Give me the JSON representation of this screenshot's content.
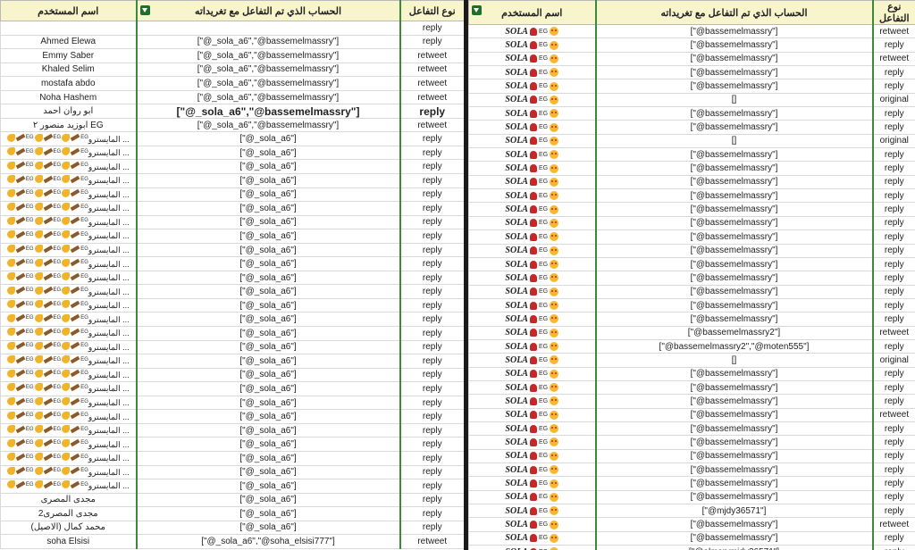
{
  "headers": {
    "interaction_type": "نوع التفاعل",
    "account": "الحساب الذي تم التفاعل مع تغريداته",
    "username": "اسم المستخدم"
  },
  "icons": {
    "filter": "filter-dropdown-icon"
  },
  "colors": {
    "header_bg": "#f8f5cc",
    "column_border": "#3b8a3b",
    "filter_button": "#1e6f2e",
    "divider": "#1a1a1a"
  },
  "left": {
    "rows": [
      {
        "u": "",
        "a": "",
        "t": "reply"
      },
      {
        "u": "Ahmed Elewa",
        "a": "[\"@_sola_a6\",\"@bassemelmassry\"]",
        "t": "reply"
      },
      {
        "u": "Emmy Saber",
        "a": "[\"@_sola_a6\",\"@bassemelmassry\"]",
        "t": "retweet"
      },
      {
        "u": "Khaled Selim",
        "a": "[\"@_sola_a6\",\"@bassemelmassry\"]",
        "t": "retweet"
      },
      {
        "u": "mostafa abdo",
        "a": "[\"@_sola_a6\",\"@bassemelmassry\"]",
        "t": "retweet"
      },
      {
        "u": "Noha Hashem",
        "a": "[\"@_sola_a6\",\"@bassemelmassry\"]",
        "t": "retweet"
      },
      {
        "u": "ابو روان احمد",
        "a": "[\"@_sola_a6\",\"@bassemelmassry\"]",
        "t": "reply",
        "bold": true
      },
      {
        "u": "ابوزيد منصور ٢ EG",
        "a": "[\"@_sola_a6\",\"@bassemelmassry\"]",
        "t": "retweet"
      },
      {
        "u": "المايسترو ...",
        "a": "[\"@_sola_a6\"]",
        "t": "reply",
        "deco": true
      },
      {
        "u": "المايسترو ...",
        "a": "[\"@_sola_a6\"]",
        "t": "reply",
        "deco": true
      },
      {
        "u": "المايسترو ...",
        "a": "[\"@_sola_a6\"]",
        "t": "reply",
        "deco": true
      },
      {
        "u": "المايسترو ...",
        "a": "[\"@_sola_a6\"]",
        "t": "reply",
        "deco": true
      },
      {
        "u": "المايسترو ...",
        "a": "[\"@_sola_a6\"]",
        "t": "reply",
        "deco": true
      },
      {
        "u": "المايسترو ...",
        "a": "[\"@_sola_a6\"]",
        "t": "reply",
        "deco": true
      },
      {
        "u": "المايسترو ...",
        "a": "[\"@_sola_a6\"]",
        "t": "reply",
        "deco": true
      },
      {
        "u": "المايسترو ...",
        "a": "[\"@_sola_a6\"]",
        "t": "reply",
        "deco": true
      },
      {
        "u": "المايسترو ...",
        "a": "[\"@_sola_a6\"]",
        "t": "reply",
        "deco": true
      },
      {
        "u": "المايسترو ...",
        "a": "[\"@_sola_a6\"]",
        "t": "reply",
        "deco": true
      },
      {
        "u": "المايسترو ...",
        "a": "[\"@_sola_a6\"]",
        "t": "reply",
        "deco": true
      },
      {
        "u": "المايسترو ...",
        "a": "[\"@_sola_a6\"]",
        "t": "reply",
        "deco": true
      },
      {
        "u": "المايسترو ...",
        "a": "[\"@_sola_a6\"]",
        "t": "reply",
        "deco": true
      },
      {
        "u": "المايسترو ...",
        "a": "[\"@_sola_a6\"]",
        "t": "reply",
        "deco": true
      },
      {
        "u": "المايسترو ...",
        "a": "[\"@_sola_a6\"]",
        "t": "reply",
        "deco": true
      },
      {
        "u": "المايسترو ...",
        "a": "[\"@_sola_a6\"]",
        "t": "reply",
        "deco": true
      },
      {
        "u": "المايسترو ...",
        "a": "[\"@_sola_a6\"]",
        "t": "reply",
        "deco": true
      },
      {
        "u": "المايسترو ...",
        "a": "[\"@_sola_a6\"]",
        "t": "reply",
        "deco": true
      },
      {
        "u": "المايسترو ...",
        "a": "[\"@_sola_a6\"]",
        "t": "reply",
        "deco": true
      },
      {
        "u": "المايسترو ...",
        "a": "[\"@_sola_a6\"]",
        "t": "reply",
        "deco": true
      },
      {
        "u": "المايسترو ...",
        "a": "[\"@_sola_a6\"]",
        "t": "reply",
        "deco": true
      },
      {
        "u": "المايسترو ...",
        "a": "[\"@_sola_a6\"]",
        "t": "reply",
        "deco": true
      },
      {
        "u": "المايسترو ...",
        "a": "[\"@_sola_a6\"]",
        "t": "reply",
        "deco": true
      },
      {
        "u": "المايسترو ...",
        "a": "[\"@_sola_a6\"]",
        "t": "reply",
        "deco": true
      },
      {
        "u": "المايسترو ...",
        "a": "[\"@_sola_a6\"]",
        "t": "reply",
        "deco": true
      },
      {
        "u": "المايسترو ...",
        "a": "[\"@_sola_a6\"]",
        "t": "reply",
        "deco": true
      },
      {
        "u": "مجدى المصرى",
        "a": "[\"@_sola_a6\"]",
        "t": "reply"
      },
      {
        "u": "مجدى المصرى2",
        "a": "[\"@_sola_a6\"]",
        "t": "reply"
      },
      {
        "u": "محمد كمال (الاصيل)",
        "a": "[\"@_sola_a6\"]",
        "t": "reply"
      },
      {
        "u": "soha Elsisi",
        "a": "[\"@_sola_a6\",\"@soha_elsisi777\"]",
        "t": "retweet"
      }
    ]
  },
  "right": {
    "user_label": "SOLA",
    "user_flag": "EG",
    "rows": [
      {
        "a": "[\"@bassemelmassry\"]",
        "t": "retweet"
      },
      {
        "a": "[\"@bassemelmassry\"]",
        "t": "reply"
      },
      {
        "a": "[\"@bassemelmassry\"]",
        "t": "retweet"
      },
      {
        "a": "[\"@bassemelmassry\"]",
        "t": "reply"
      },
      {
        "a": "[\"@bassemelmassry\"]",
        "t": "reply"
      },
      {
        "a": "[]",
        "t": "original"
      },
      {
        "a": "[\"@bassemelmassry\"]",
        "t": "reply"
      },
      {
        "a": "[\"@bassemelmassry\"]",
        "t": "reply"
      },
      {
        "a": "[]",
        "t": "original"
      },
      {
        "a": "[\"@bassemelmassry\"]",
        "t": "reply"
      },
      {
        "a": "[\"@bassemelmassry\"]",
        "t": "reply"
      },
      {
        "a": "[\"@bassemelmassry\"]",
        "t": "reply"
      },
      {
        "a": "[\"@bassemelmassry\"]",
        "t": "reply"
      },
      {
        "a": "[\"@bassemelmassry\"]",
        "t": "reply"
      },
      {
        "a": "[\"@bassemelmassry\"]",
        "t": "reply"
      },
      {
        "a": "[\"@bassemelmassry\"]",
        "t": "reply"
      },
      {
        "a": "[\"@bassemelmassry\"]",
        "t": "reply"
      },
      {
        "a": "[\"@bassemelmassry\"]",
        "t": "reply"
      },
      {
        "a": "[\"@bassemelmassry\"]",
        "t": "reply"
      },
      {
        "a": "[\"@bassemelmassry\"]",
        "t": "reply"
      },
      {
        "a": "[\"@bassemelmassry\"]",
        "t": "reply"
      },
      {
        "a": "[\"@bassemelmassry\"]",
        "t": "reply"
      },
      {
        "a": "[\"@bassemelmassry2\"]",
        "t": "retweet"
      },
      {
        "a": "[\"@bassemelmassry2\",\"@moten555\"]",
        "t": "reply"
      },
      {
        "a": "[]",
        "t": "original"
      },
      {
        "a": "[\"@bassemelmassry\"]",
        "t": "reply"
      },
      {
        "a": "[\"@bassemelmassry\"]",
        "t": "reply"
      },
      {
        "a": "[\"@bassemelmassry\"]",
        "t": "reply"
      },
      {
        "a": "[\"@bassemelmassry\"]",
        "t": "retweet"
      },
      {
        "a": "[\"@bassemelmassry\"]",
        "t": "reply"
      },
      {
        "a": "[\"@bassemelmassry\"]",
        "t": "reply"
      },
      {
        "a": "[\"@bassemelmassry\"]",
        "t": "reply"
      },
      {
        "a": "[\"@bassemelmassry\"]",
        "t": "reply"
      },
      {
        "a": "[\"@bassemelmassry\"]",
        "t": "reply"
      },
      {
        "a": "[\"@bassemelmassry\"]",
        "t": "reply"
      },
      {
        "a": "[\"@mjdy36571\"]",
        "t": "reply"
      },
      {
        "a": "[\"@bassemelmassry\"]",
        "t": "retweet"
      },
      {
        "a": "[\"@bassemelmassry\"]",
        "t": "reply"
      },
      {
        "a": "[\"@almsrymjdy36571\"]",
        "t": "reply"
      },
      {
        "a": "[\"@bassemelmassry\"]",
        "t": "reply"
      }
    ]
  }
}
